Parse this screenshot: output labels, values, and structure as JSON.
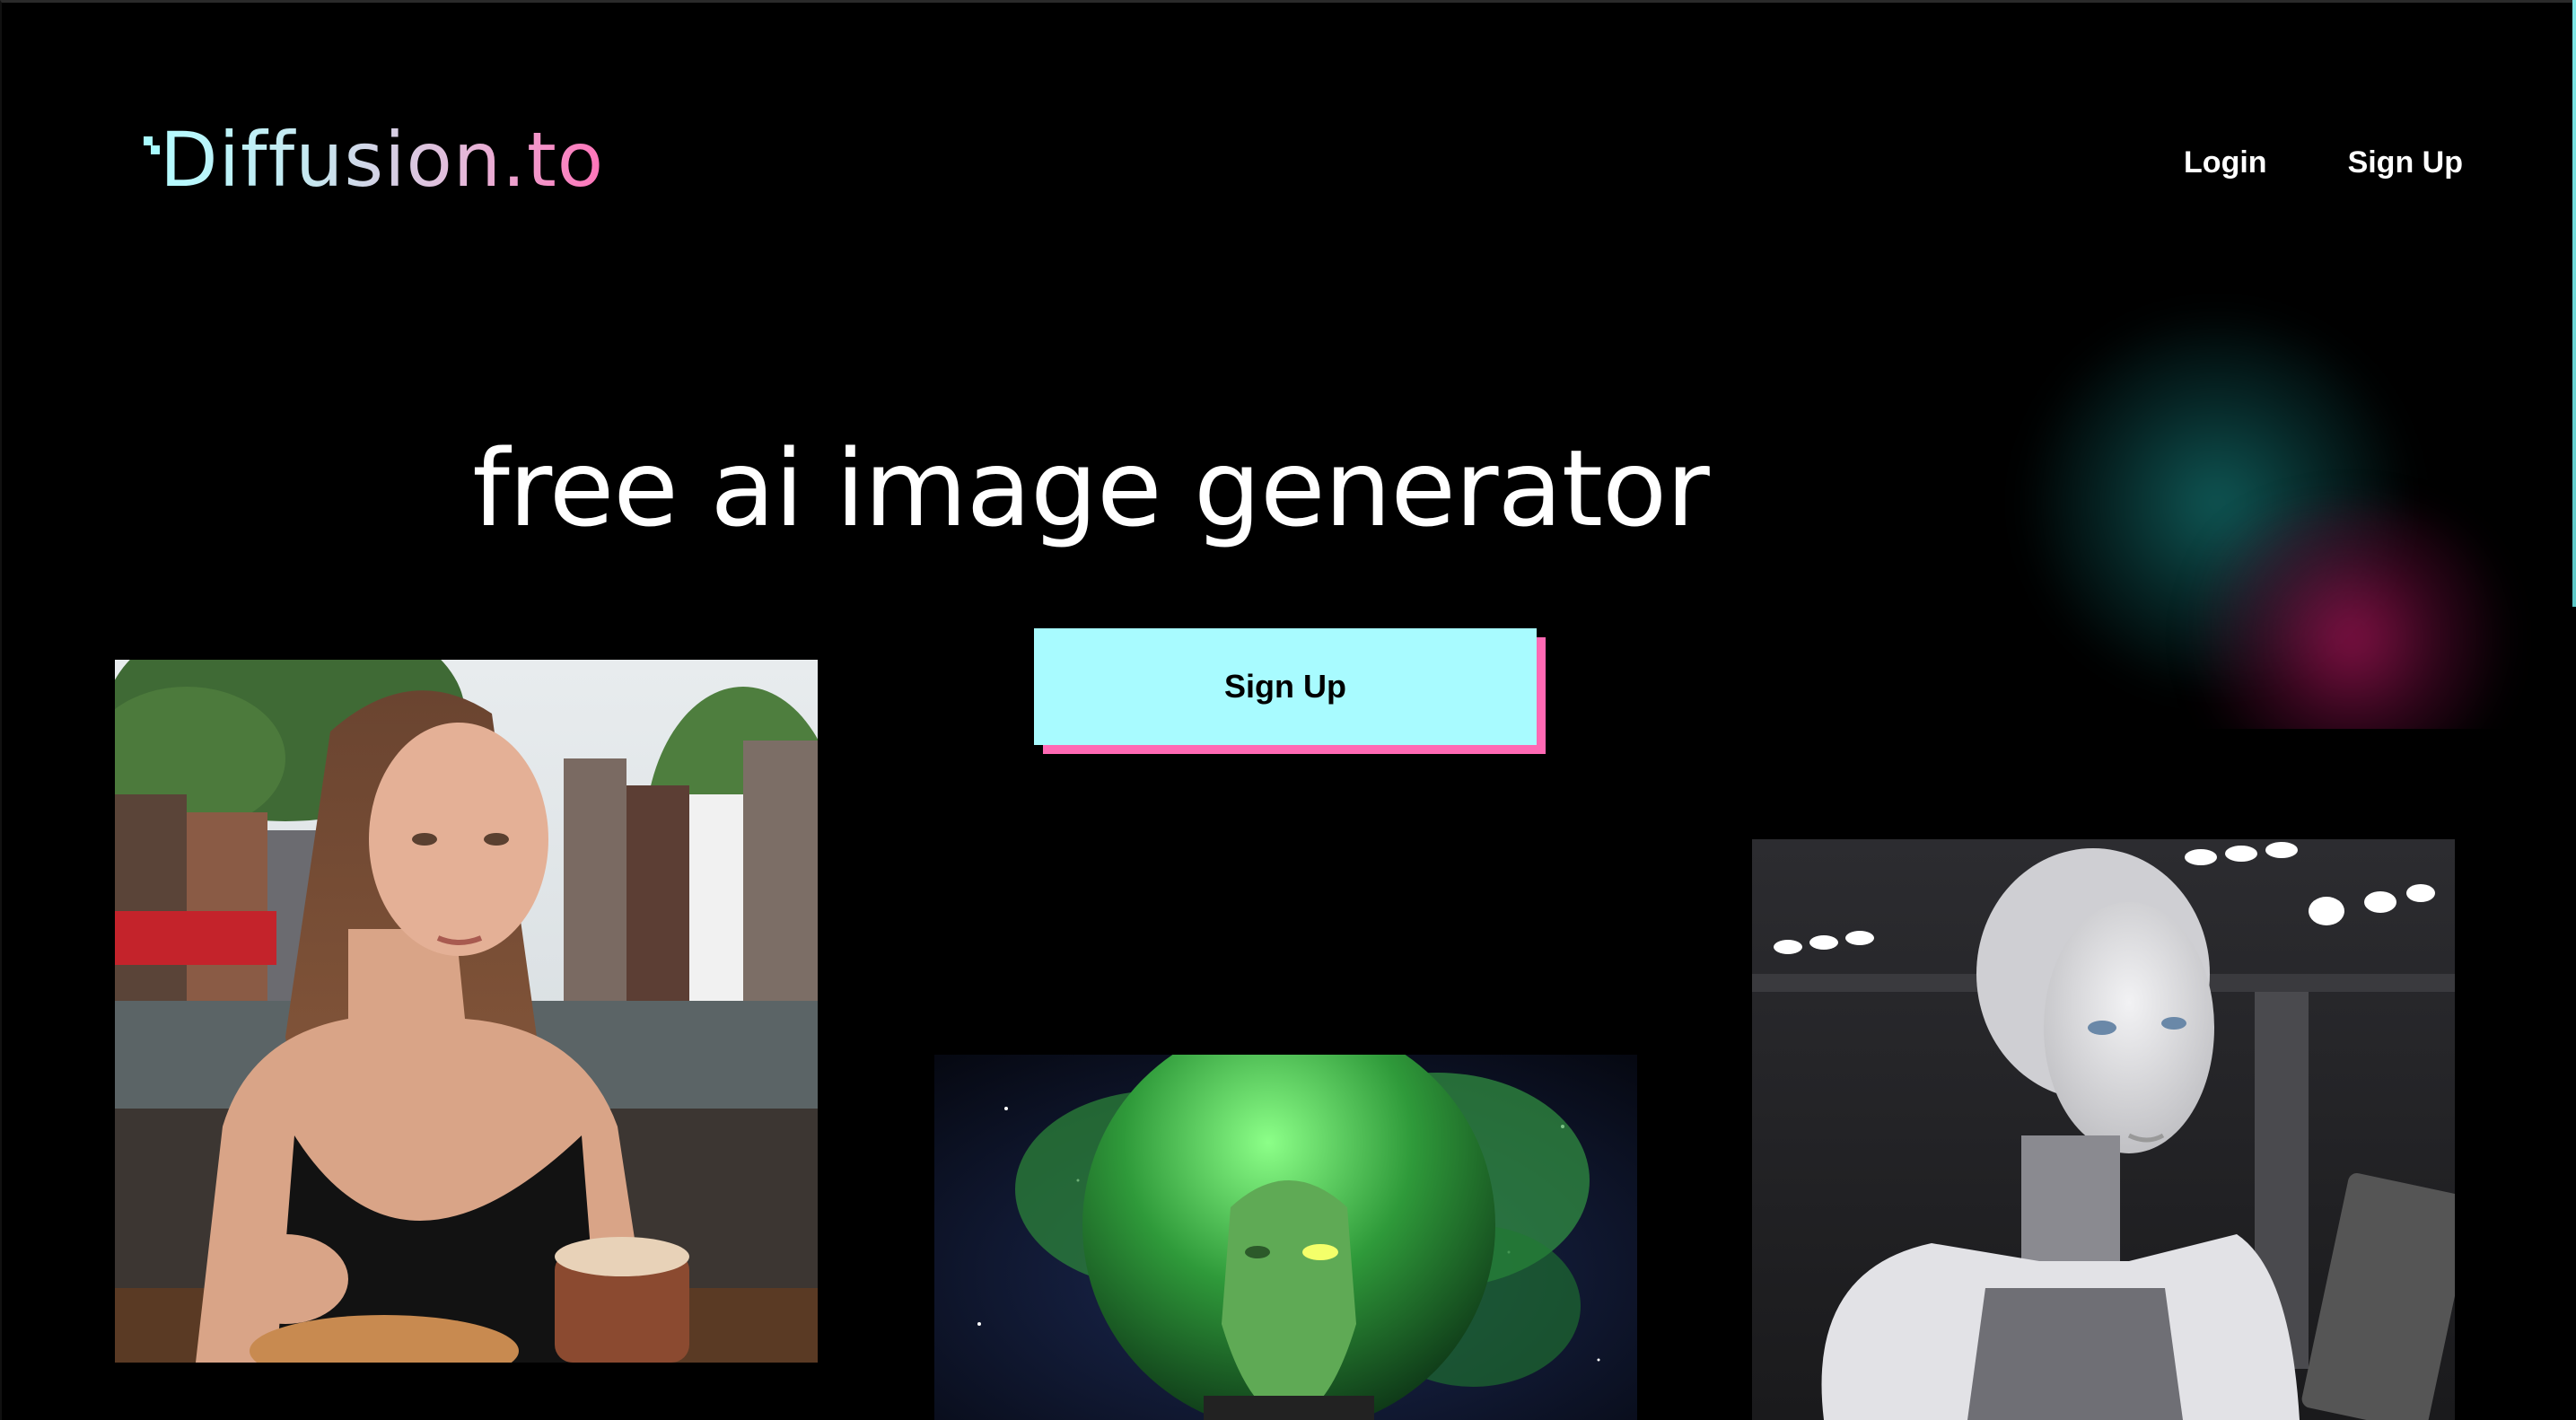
{
  "logo": {
    "text": "Diffusion.to"
  },
  "nav": {
    "login": "Login",
    "signup": "Sign Up"
  },
  "hero": {
    "headline": "free ai image generator",
    "cta_label": "Sign Up"
  },
  "colors": {
    "background": "#000000",
    "accent_cyan": "#a8fbff",
    "accent_pink": "#ff69b4"
  },
  "gallery": {
    "images": [
      {
        "subject": "woman at cafe table with latte"
      },
      {
        "subject": "green alien astronaut in space"
      },
      {
        "subject": "silver humanoid robot"
      }
    ]
  }
}
